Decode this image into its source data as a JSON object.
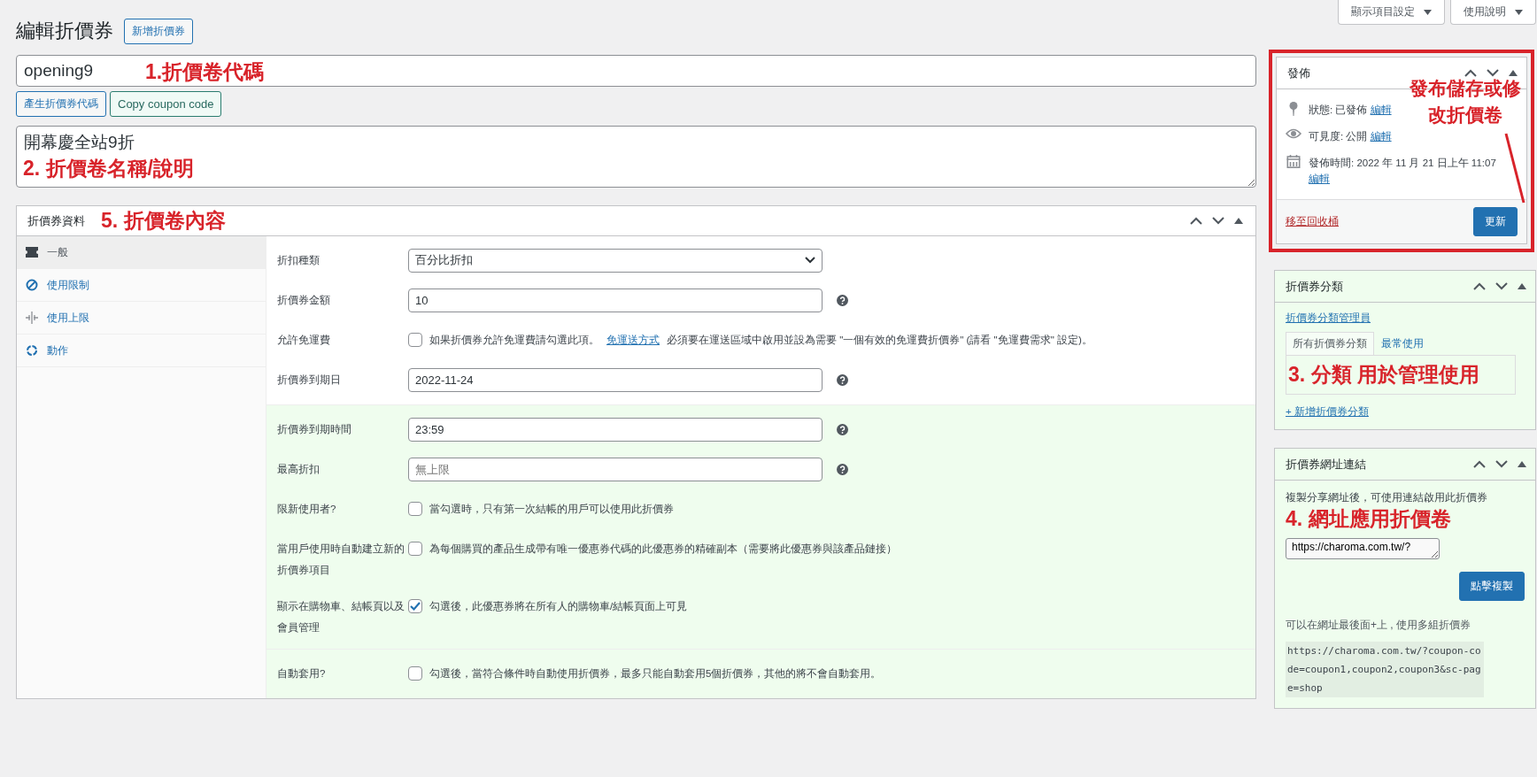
{
  "screen_buttons": [
    {
      "label": "顯示項目設定"
    },
    {
      "label": "使用說明"
    }
  ],
  "header": {
    "title": "編輯折價券",
    "add_button": "新增折價券"
  },
  "coupon_code": {
    "value": "opening9",
    "annotation": "1.折價卷代碼",
    "generate_button": "產生折價券代碼",
    "copy_button": "Copy coupon code"
  },
  "description": {
    "value": "開幕慶全站9折",
    "annotation": "2. 折價卷名稱/說明"
  },
  "coupon_data": {
    "title": "折價券資料",
    "annotation": "5. 折價卷內容",
    "tabs": [
      {
        "label": "一般",
        "kind": "ticket",
        "selected": true
      },
      {
        "label": "使用限制",
        "kind": "ban",
        "selected": false
      },
      {
        "label": "使用上限",
        "kind": "limit",
        "selected": false
      },
      {
        "label": "動作",
        "kind": "cycle",
        "selected": false
      }
    ],
    "sections": [
      {
        "highlighted": false,
        "rows": [
          {
            "kind": "select",
            "label": "折扣種類",
            "value": "百分比折扣",
            "help": false
          },
          {
            "kind": "input",
            "label": "折價券金額",
            "value": "10",
            "help": true
          },
          {
            "kind": "checkbox",
            "label": "允許免運費",
            "checked": false,
            "text": "如果折價券允許免運費請勾選此項。",
            "link": "免運送方式",
            "text_after": "必須要在運送區域中啟用並設為需要 \"一個有效的免運費折價券\" (請看 \"免運費需求\" 設定)。"
          },
          {
            "kind": "input",
            "label": "折價券到期日",
            "value": "2022-11-24",
            "help": true
          }
        ]
      },
      {
        "highlighted": true,
        "rows": [
          {
            "kind": "input",
            "label": "折價券到期時間",
            "value": "23:59",
            "help": true
          },
          {
            "kind": "input",
            "label": "最高折扣",
            "placeholder": "無上限",
            "help": true
          },
          {
            "kind": "checkbox",
            "label": "限新使用者?",
            "checked": false,
            "text": "當勾選時，只有第一次結帳的用戶可以使用此折價券"
          },
          {
            "kind": "checkbox",
            "label": "當用戶使用時自動建立新的折價券項目",
            "checked": false,
            "text": "為每個購買的產品生成帶有唯一優惠券代碼的此優惠券的精確副本（需要將此優惠券與該產品鏈接）"
          },
          {
            "kind": "checkbox",
            "label": "顯示在購物車、結帳頁以及會員管理",
            "checked": true,
            "text": "勾選後，此優惠券將在所有人的購物車/結帳頁面上可見"
          }
        ]
      },
      {
        "highlighted": true,
        "rows": [
          {
            "kind": "checkbox",
            "label": "自動套用?",
            "checked": false,
            "text": "勾選後，當符合條件時自動使用折價券，最多只能自動套用5個折價券，其他的將不會自動套用。"
          }
        ]
      }
    ]
  },
  "publish": {
    "title": "發佈",
    "annotation": [
      "發布儲存或修",
      "改折價卷"
    ],
    "items": [
      {
        "kind": "status",
        "text": "狀態: 已發佈",
        "link": "編輯"
      },
      {
        "kind": "visibility",
        "text": "可見度: 公開",
        "link": "編輯"
      },
      {
        "kind": "date",
        "text": "發佈時間: 2022 年 11 月 21 日上午 11:07",
        "link": "編輯"
      }
    ],
    "trash_link": "移至回收桶",
    "update_button": "更新"
  },
  "categories": {
    "title": "折價券分類",
    "manage_link": "折價券分類管理員",
    "tabs": [
      {
        "label": "所有折價券分類",
        "selected": true
      },
      {
        "label": "最常使用",
        "selected": false
      }
    ],
    "annotation": "3. 分類 用於管理使用",
    "add_link": "+ 新增折價券分類"
  },
  "url_box": {
    "title": "折價券網址連結",
    "text": "複製分享網址後，可使用連結啟用此折價券",
    "annotation": "4. 網址應用折價卷",
    "url": "https://charoma.com.tw/?",
    "copy_button": "點擊複製",
    "note": "可以在網址最後面+上 , 使用多組折價券",
    "example": "https://charoma.com.tw/?coupon-code=coupon1,coupon2,coupon3&sc-page=shop"
  }
}
